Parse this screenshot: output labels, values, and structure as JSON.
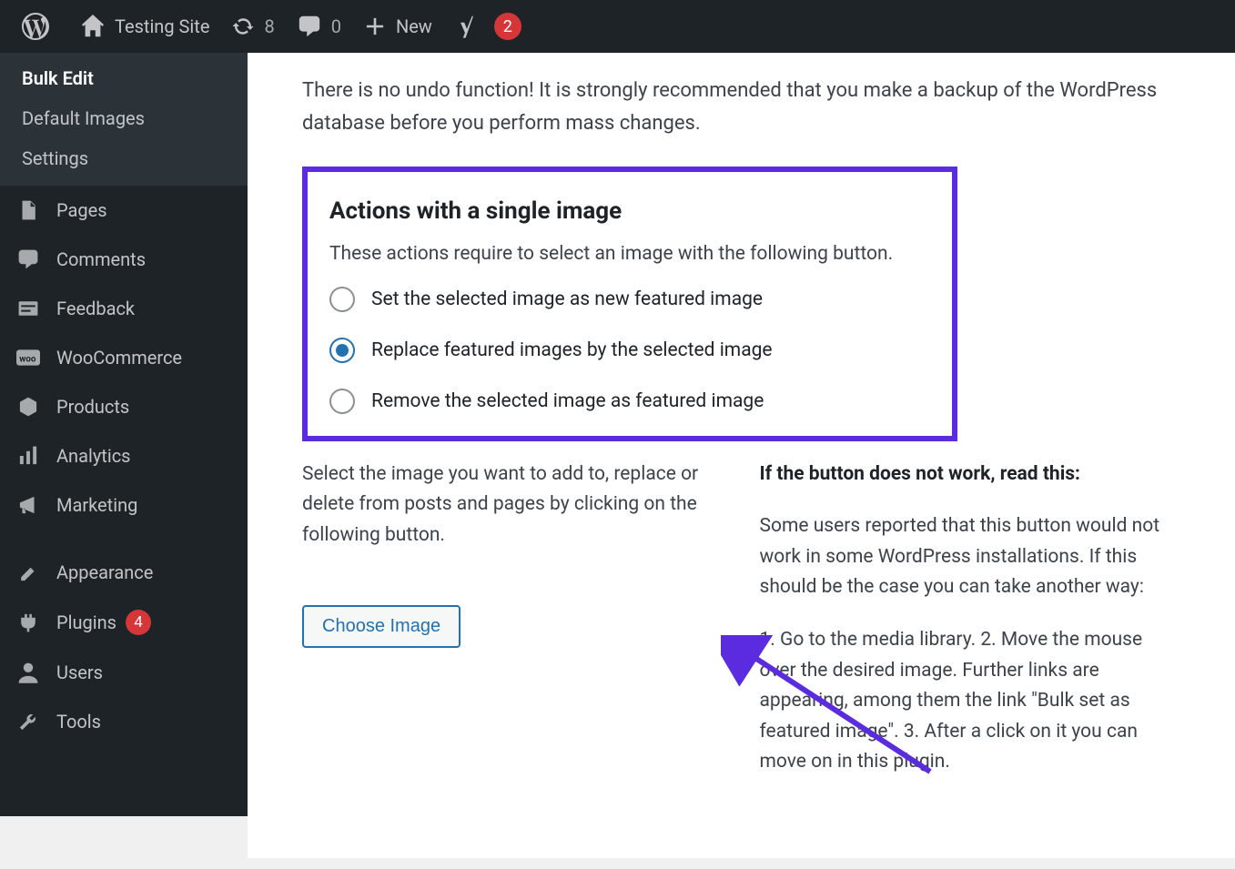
{
  "adminBar": {
    "siteTitle": "Testing Site",
    "updatesCount": "8",
    "commentsCount": "0",
    "newLabel": "New",
    "yoastCount": "2"
  },
  "sidebar": {
    "submenu": [
      {
        "label": "Bulk Edit",
        "current": true
      },
      {
        "label": "Default Images",
        "current": false
      },
      {
        "label": "Settings",
        "current": false
      }
    ],
    "menu": [
      {
        "icon": "pages-icon",
        "label": "Pages"
      },
      {
        "icon": "comment-icon",
        "label": "Comments"
      },
      {
        "icon": "feedback-icon",
        "label": "Feedback"
      },
      {
        "icon": "woo-icon",
        "label": "WooCommerce"
      },
      {
        "icon": "products-icon",
        "label": "Products"
      },
      {
        "icon": "analytics-icon",
        "label": "Analytics"
      },
      {
        "icon": "marketing-icon",
        "label": "Marketing"
      },
      {
        "icon": "appearance-icon",
        "label": "Appearance"
      },
      {
        "icon": "plugins-icon",
        "label": "Plugins",
        "badge": "4"
      },
      {
        "icon": "users-icon",
        "label": "Users"
      },
      {
        "icon": "tools-icon",
        "label": "Tools"
      }
    ]
  },
  "content": {
    "warning": "There is no undo function! It is strongly recommended that you make a backup of the WordPress database before you perform mass changes.",
    "box": {
      "heading": "Actions with a single image",
      "intro": "These actions require to select an image with the following button.",
      "options": [
        {
          "label": "Set the selected image as new featured image",
          "checked": false
        },
        {
          "label": "Replace featured images by the selected image",
          "checked": true
        },
        {
          "label": "Remove the selected image as featured image",
          "checked": false
        }
      ]
    },
    "leftCol": {
      "text": "Select the image you want to add to, replace or delete from posts and pages by clicking on the following button.",
      "button": "Choose Image"
    },
    "rightCol": {
      "heading": "If the button does not work, read this:",
      "p1": "Some users reported that this button would not work in some WordPress installations. If this should be the case you can take another way:",
      "p2": "1. Go to the media library. 2. Move the mouse over the desired image. Further links are appearing, among them the link \"Bulk set as featured image\". 3. After a click on it you can move on in this plugin."
    }
  }
}
